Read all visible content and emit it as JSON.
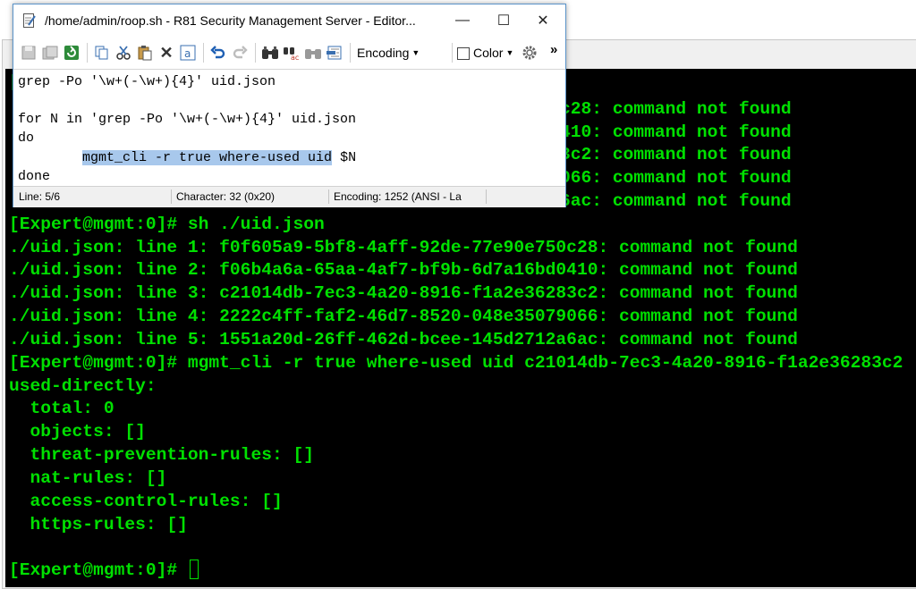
{
  "colors": {
    "terminal_bg": "#000000",
    "terminal_fg": "#00e000",
    "selection": "#a8c8ec",
    "window_border": "#5a93c9"
  },
  "editor": {
    "title": "/home/admin/roop.sh - R81 Security Management Server - Editor...",
    "title_icon": "notepad-pencil-icon",
    "window_controls": {
      "minimize": "—",
      "maximize": "☐",
      "close": "✕"
    },
    "toolbar": {
      "icons": [
        "save-icon",
        "save-all-icon",
        "reload-icon",
        "copy-icon",
        "cut-icon",
        "paste-icon",
        "delete-icon",
        "select-all-icon",
        "undo-icon",
        "redo-icon",
        "find-icon",
        "replace-icon",
        "find-next-icon",
        "goto-icon"
      ],
      "encoding_label": "Encoding",
      "color_label": "Color",
      "more": "»"
    },
    "code_lines": [
      "grep -Po '\\w+(-\\w+){4}' uid.json",
      "",
      "for N in 'grep -Po '\\w+(-\\w+){4}' uid.json",
      "do"
    ],
    "indent": "        ",
    "selected_text": "mgmt_cli -r true where-used uid",
    "after_selection": " $N",
    "last_line": "done",
    "status": {
      "line": "Line: 5/6",
      "character": "Character: 32 (0x20)",
      "encoding": "Encoding: 1252  (ANSI - La"
    }
  },
  "terminal": {
    "hidden_lines": [
      "c28: command not found",
      "410: command not found",
      "3c2: command not found",
      "066: command not found",
      "6ac: command not found"
    ],
    "lines": [
      "[Expert@mgmt:0]# sh ./uid.json",
      "./uid.json: line 1: f0f605a9-5bf8-4aff-92de-77e90e750c28: command not found",
      "./uid.json: line 2: f06b4a6a-65aa-4af7-bf9b-6d7a16bd0410: command not found",
      "./uid.json: line 3: c21014db-7ec3-4a20-8916-f1a2e36283c2: command not found",
      "./uid.json: line 4: 2222c4ff-faf2-46d7-8520-048e35079066: command not found",
      "./uid.json: line 5: 1551a20d-26ff-462d-bcee-145d2712a6ac: command not found",
      "[Expert@mgmt:0]# mgmt_cli -r true where-used uid c21014db-7ec3-4a20-8916-f1a2e36283c2",
      "used-directly:",
      "  total: 0",
      "  objects: []",
      "  threat-prevention-rules: []",
      "  nat-rules: []",
      "  access-control-rules: []",
      "  https-rules: []",
      ""
    ],
    "prompt": "[Expert@mgmt:0]# "
  }
}
